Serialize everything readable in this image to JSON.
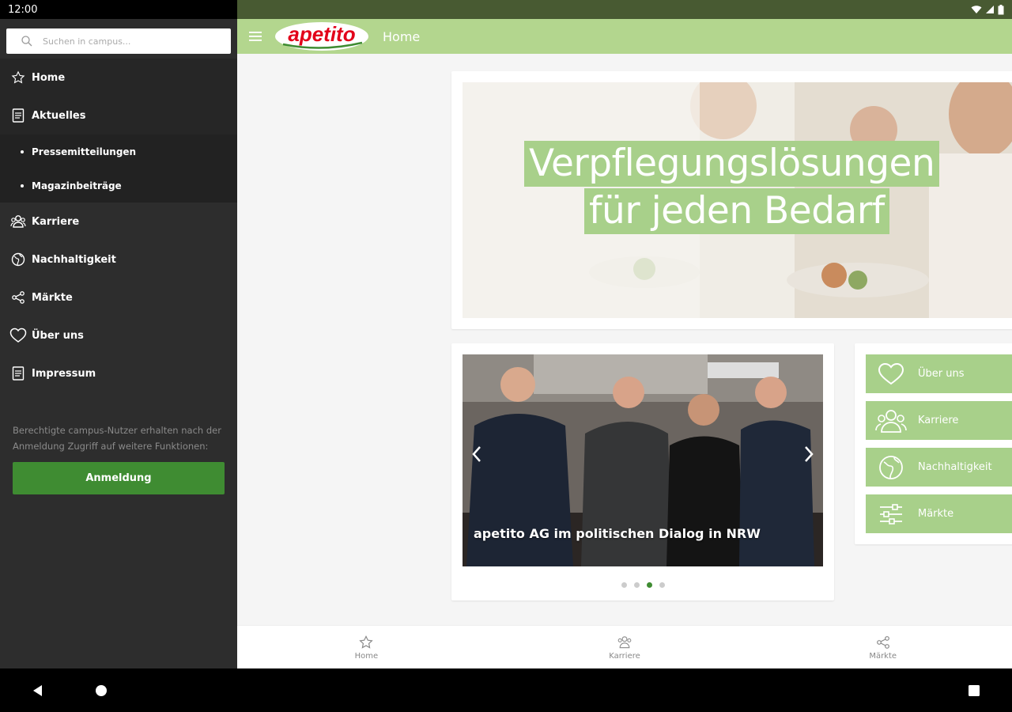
{
  "status_bar": {
    "time": "12:00"
  },
  "sidebar": {
    "search_placeholder": "Suchen in campus...",
    "items": [
      {
        "label": "Home",
        "icon": "star-icon"
      },
      {
        "label": "Aktuelles",
        "icon": "document-icon"
      },
      {
        "label": "Karriere",
        "icon": "people-icon"
      },
      {
        "label": "Nachhaltigkeit",
        "icon": "globe-icon"
      },
      {
        "label": "Märkte",
        "icon": "share-icon"
      },
      {
        "label": "Über uns",
        "icon": "heart-icon"
      },
      {
        "label": "Impressum",
        "icon": "document-icon"
      }
    ],
    "subitems": [
      {
        "label": "Pressemitteilungen"
      },
      {
        "label": "Magazinbeiträge"
      }
    ],
    "note": "Berechtigte campus-Nutzer erhalten nach der Anmeldung Zugriff auf weitere Funktionen:",
    "login_button": "Anmeldung"
  },
  "appbar": {
    "logo_text": "apetito",
    "title": "Home"
  },
  "hero": {
    "headline_line1": "Verpflegungslösungen",
    "headline_line2": "für jeden Bedarf"
  },
  "slider": {
    "caption": "apetito AG im politischen Dialog in NRW",
    "slide_count": 4,
    "active_index": 2
  },
  "quick_links": [
    {
      "label": "Über uns",
      "icon": "heart-icon"
    },
    {
      "label": "Karriere",
      "icon": "people-icon"
    },
    {
      "label": "Nachhaltigkeit",
      "icon": "globe-icon"
    },
    {
      "label": "Märkte",
      "icon": "sliders-icon"
    }
  ],
  "bottom_tabs": [
    {
      "label": "Home",
      "icon": "star-icon"
    },
    {
      "label": "Karriere",
      "icon": "people-icon"
    },
    {
      "label": "Märkte",
      "icon": "share-icon"
    }
  ],
  "colors": {
    "brand_green": "#b3d68e",
    "tile_green": "#a8d08a",
    "button_green": "#3f8c32",
    "sidebar_bg": "#2d2d2d",
    "logo_red": "#e2001a"
  }
}
